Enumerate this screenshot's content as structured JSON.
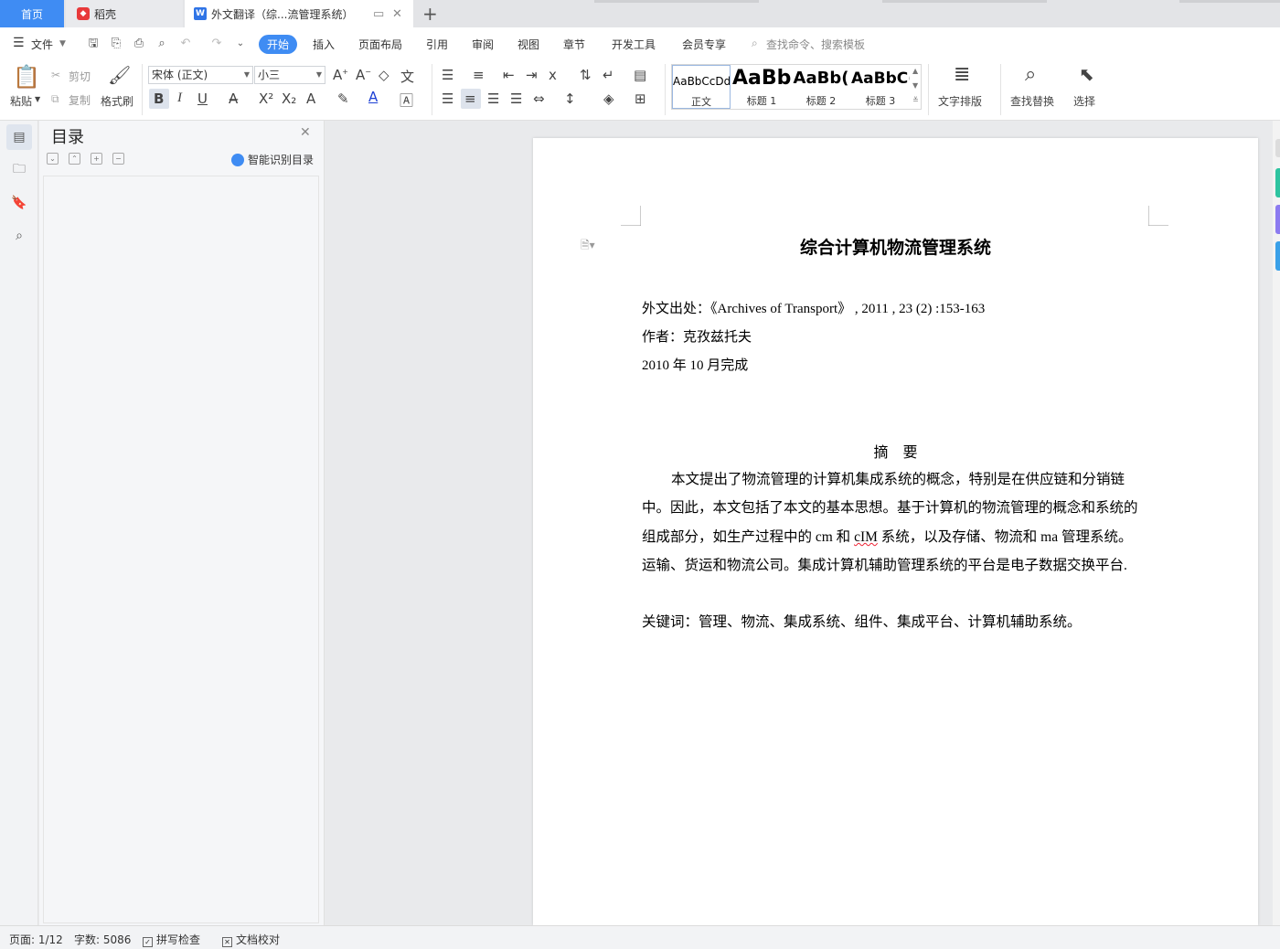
{
  "tabs": {
    "home": "首页",
    "daoke": "稻壳",
    "doc": "外文翻译（综...流管理系统）"
  },
  "menu": {
    "file": "文件",
    "start": "开始",
    "insert": "插入",
    "layout": "页面布局",
    "reference": "引用",
    "review": "审阅",
    "view": "视图",
    "chapter": "章节",
    "dev": "开发工具",
    "vip": "会员专享",
    "search": "查找命令、搜索模板"
  },
  "ribbon": {
    "paste": "粘贴",
    "cut": "剪切",
    "copy": "复制",
    "format_painter": "格式刷",
    "font_name": "宋体 (正文)",
    "font_size": "小三",
    "styles": [
      {
        "sample": "AaBbCcDd",
        "label": "正文"
      },
      {
        "sample": "AaBb",
        "label": "标题 1"
      },
      {
        "sample": "AaBb(",
        "label": "标题 2"
      },
      {
        "sample": "AaBbC(",
        "label": "标题 3"
      }
    ],
    "text_layout": "文字排版",
    "find_replace": "查找替换",
    "select": "选择"
  },
  "toc": {
    "title": "目录",
    "smart": "智能识别目录"
  },
  "document": {
    "title": "综合计算机物流管理系统",
    "source": "外文出处：《Archives of Transport》 , 2011 , 23 (2) :153-163",
    "author": "作者：克孜兹托夫",
    "date": "2010 年 10 月完成",
    "abstract_heading": "摘　要",
    "abstract": {
      "l1": "本文提出了物流管理的计算机集成系统的概念，特别是在供应链和分销链",
      "l2": "中。因此，本文包括了本文的基本思想。基于计算机的物流管理的概念和系统的",
      "l3a": "组成部分，如生产过程中的 cm 和 ",
      "l3b": "cIM",
      "l3c": " 系统，以及存储、物流和 ma 管理系统。",
      "l4": "运输、货运和物流公司。集成计算机辅助管理系统的平台是电子数据交换平台."
    },
    "keywords": "关键词：管理、物流、集成系统、组件、集成平台、计算机辅助系统。"
  },
  "status": {
    "page": "页面: 1/12",
    "words": "字数: 5086",
    "spell": "拼写检查",
    "proof": "文档校对"
  },
  "colors": {
    "accent": "#3f8cf3",
    "rail1": "#2ec4a0",
    "rail2": "#8c7bf0",
    "rail3": "#3aa0e8"
  }
}
